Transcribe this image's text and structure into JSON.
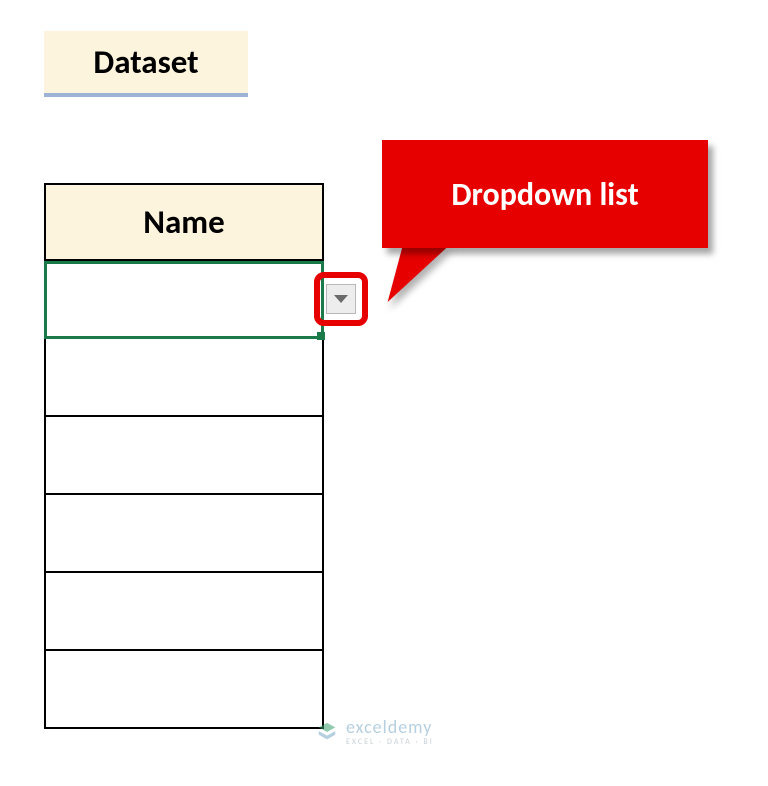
{
  "title": "Dataset",
  "table": {
    "header": "Name",
    "rows": [
      "",
      "",
      "",
      "",
      "",
      ""
    ]
  },
  "callout_label": "Dropdown list",
  "watermark": {
    "brand": "exceldemy",
    "tagline": "EXCEL · DATA · BI"
  },
  "colors": {
    "header_fill": "#fdf4dd",
    "accent_red": "#e60000",
    "selection_green": "#1a7a4a",
    "title_underline": "#9cb3d6"
  }
}
